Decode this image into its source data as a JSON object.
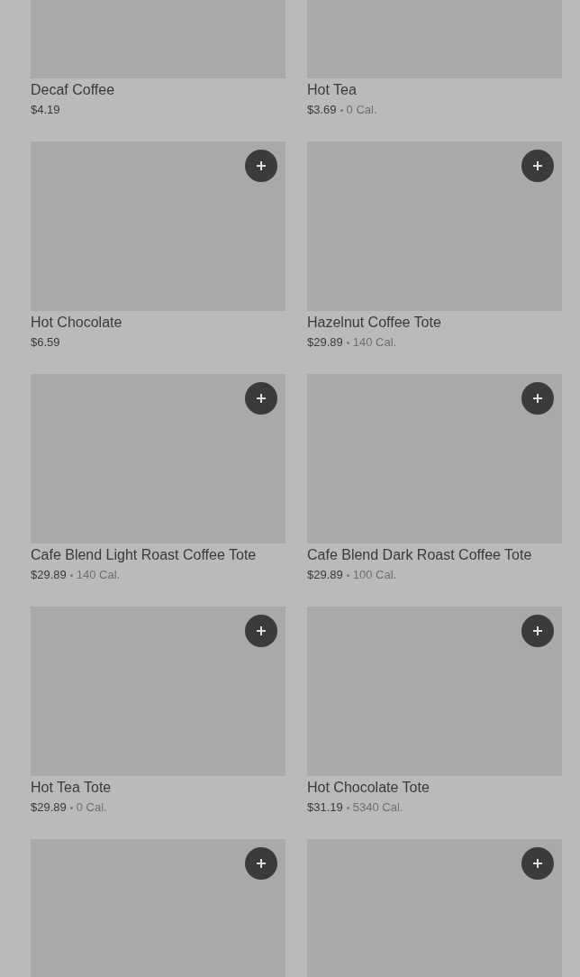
{
  "products": [
    {
      "kind": "listing",
      "name": "Decaf Coffee",
      "price": "$4.19"
    },
    {
      "kind": "listing",
      "name": "Hot Tea",
      "price": "$3.69",
      "calories": "0 Cal."
    },
    {
      "kind": "listing",
      "name": "Hot Chocolate",
      "price": "$6.59"
    },
    {
      "kind": "listing",
      "name": "Hazelnut Coffee Tote",
      "price": "$29.89",
      "calories": "140 Cal."
    },
    {
      "kind": "listing",
      "name": "Cafe Blend Light Roast Coffee Tote",
      "price": "$29.89",
      "calories": "140 Cal."
    },
    {
      "kind": "listing",
      "name": "Cafe Blend Dark Roast Coffee Tote",
      "price": "$29.89",
      "calories": "100 Cal."
    },
    {
      "kind": "listing",
      "name": "Hot Tea Tote",
      "price": "$29.89",
      "calories": "0 Cal."
    },
    {
      "kind": "listing",
      "name": "Hot Chocolate Tote",
      "price": "$31.19",
      "calories": "5340 Cal."
    },
    {
      "kind": "image_only"
    },
    {
      "kind": "image_only"
    }
  ]
}
